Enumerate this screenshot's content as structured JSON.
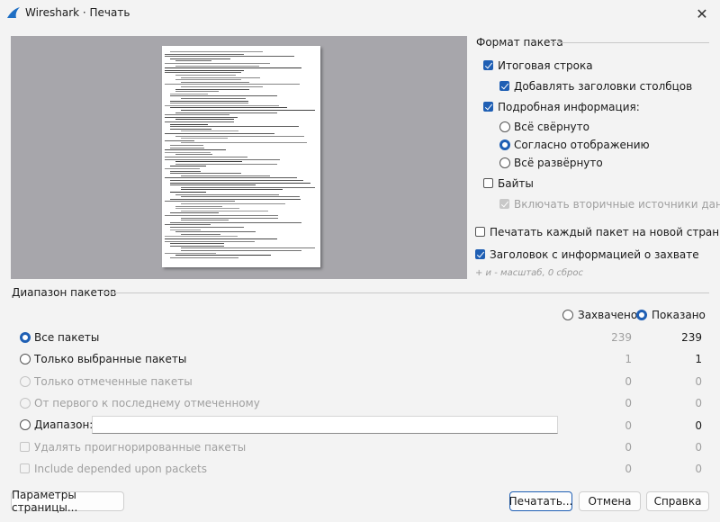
{
  "window": {
    "title": "Wireshark · Печать"
  },
  "packet_format": {
    "title": "Формат пакета",
    "summary_line": {
      "label": "Итоговая строка",
      "checked": true
    },
    "column_headers": {
      "label": "Добавлять заголовки столбцов",
      "checked": true
    },
    "details": {
      "label": "Подробная информация:",
      "checked": true
    },
    "all_collapsed": {
      "label": "Всё свёрнуто",
      "selected": false
    },
    "as_displayed": {
      "label": "Согласно отображению",
      "selected": true
    },
    "all_expanded": {
      "label": "Всё развёрнуто",
      "selected": false
    },
    "bytes": {
      "label": "Байты",
      "checked": false
    },
    "secondary_sources": {
      "label": "Включать вторичные источники данных",
      "checked": true,
      "disabled": true
    },
    "new_page": {
      "label": "Печатать каждый пакет на новой странице",
      "checked": false
    },
    "capture_header": {
      "label": "Заголовок с информацией о захвате",
      "checked": true
    },
    "zoom_hint": "+ и - масштаб, 0 сброс"
  },
  "packet_range": {
    "title": "Диапазон пакетов",
    "captured": {
      "label": "Захвачено",
      "selected": false
    },
    "displayed": {
      "label": "Показано",
      "selected": true
    },
    "rows": [
      {
        "label": "Все пакеты",
        "captured": "239",
        "displayed": "239"
      },
      {
        "label": "Только выбранные пакеты",
        "captured": "1",
        "displayed": "1"
      },
      {
        "label": "Только отмеченные пакеты",
        "captured": "0",
        "displayed": "0"
      },
      {
        "label": "От первого к последнему отмеченному",
        "captured": "0",
        "displayed": "0"
      },
      {
        "label": "Диапазон:",
        "captured": "0",
        "displayed": "0",
        "input_value": ""
      },
      {
        "label": "Удалять проигнорированные пакеты",
        "captured": "0",
        "displayed": "0"
      },
      {
        "label": "Include depended upon packets",
        "captured": "0",
        "displayed": "0"
      }
    ]
  },
  "buttons": {
    "page_setup": "Параметры страницы...",
    "print": "Печатать...",
    "cancel": "Отмена",
    "help": "Справка"
  }
}
